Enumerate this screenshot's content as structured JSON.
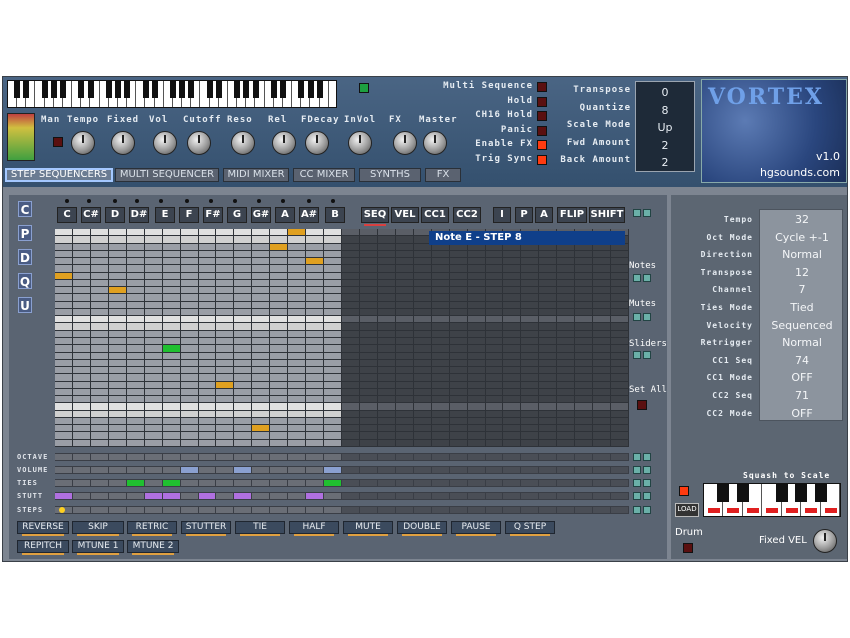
{
  "header": {
    "knob_labels": [
      "Man",
      "Tempo",
      "Fixed",
      "Vol",
      "Cutoff",
      "Reso",
      "Rel",
      "FDecay",
      "InVol",
      "FX",
      "Master"
    ],
    "toggles": [
      "Multi Sequence",
      "Hold",
      "CH16 Hold",
      "Panic",
      "Enable FX",
      "Trig Sync"
    ],
    "settings": [
      {
        "label": "Transpose",
        "value": "0"
      },
      {
        "label": "Quantize",
        "value": "8"
      },
      {
        "label": "Scale Mode",
        "value": "Up"
      },
      {
        "label": "Fwd Amount",
        "value": "2"
      },
      {
        "label": "Back Amount",
        "value": "2"
      }
    ],
    "logo_title": "VORTEX",
    "logo_version": "v1.0",
    "logo_site": "hgsounds.com"
  },
  "tabs": [
    "STEP SEQUENCERS",
    "MULTI SEQUENCER",
    "MIDI MIXER",
    "CC MIXER",
    "SYNTHS",
    "FX"
  ],
  "sequencer": {
    "side_letters": [
      "C",
      "P",
      "D",
      "Q",
      "U"
    ],
    "notes": [
      "C",
      "C#",
      "D",
      "D#",
      "E",
      "F",
      "F#",
      "G",
      "G#",
      "A",
      "A#",
      "B"
    ],
    "mode_buttons": [
      "SEQ",
      "VEL",
      "CC1",
      "CC2"
    ],
    "edit_buttons": [
      "I",
      "P",
      "A",
      "FLIP",
      "SHIFT"
    ],
    "tooltip": "Note E  - STEP 8",
    "side_labels": {
      "notes": "Notes",
      "mutes": "Mutes",
      "sliders": "Sliders",
      "set_all": "Set All"
    },
    "lanes": [
      "OCTAVE",
      "VOLUME",
      "TIES",
      "STUTT",
      "STEPS"
    ]
  },
  "functions": {
    "row1": [
      "REVERSE",
      "SKIP",
      "RETRIC",
      "STUTTER",
      "TIE",
      "HALF",
      "MUTE",
      "DOUBLE",
      "PAUSE",
      "Q STEP"
    ],
    "row2": [
      "REPITCH",
      "MTUNE 1",
      "MTUNE 2"
    ]
  },
  "params": [
    {
      "label": "Tempo",
      "value": "32"
    },
    {
      "label": "Oct Mode",
      "value": "Cycle +-1"
    },
    {
      "label": "Direction",
      "value": "Normal"
    },
    {
      "label": "Transpose",
      "value": "12"
    },
    {
      "label": "Channel",
      "value": "7"
    },
    {
      "label": "Ties Mode",
      "value": "Tied"
    },
    {
      "label": "Velocity",
      "value": "Sequenced"
    },
    {
      "label": "Retrigger",
      "value": "Normal"
    },
    {
      "label": "CC1 Seq",
      "value": "74"
    },
    {
      "label": "CC1 Mode",
      "value": "OFF"
    },
    {
      "label": "CC2 Seq",
      "value": "71"
    },
    {
      "label": "CC2 Mode",
      "value": "OFF"
    }
  ],
  "bottom_right": {
    "squash_label": "Squash to Scale",
    "load_label": "LOAD",
    "drum_label": "Drum",
    "fixed_vel_label": "Fixed VEL"
  },
  "colors": {
    "accent": "#ffa020",
    "active_step": "#e0a020",
    "green_step": "#20c030",
    "tooltip_bg": "#0f3f8a"
  }
}
